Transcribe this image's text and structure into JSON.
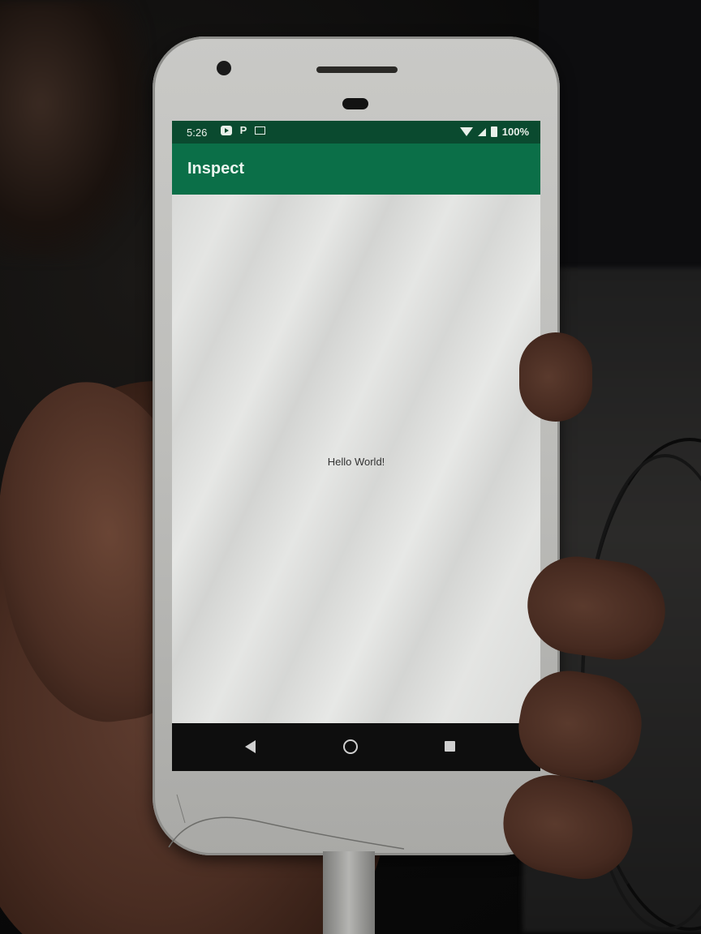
{
  "status_bar": {
    "time": "5:26",
    "battery": "100%",
    "icons_left": [
      "youtube-icon",
      "p-icon",
      "mail-icon"
    ],
    "icons_right": [
      "wifi-icon",
      "signal-icon",
      "battery-icon"
    ],
    "p_glyph": "P"
  },
  "app_bar": {
    "title": "Inspect",
    "color": "#0b6f48"
  },
  "content": {
    "text": "Hello World!",
    "background": "#e0e1df"
  },
  "nav_bar": {
    "buttons": [
      "back-icon",
      "home-icon",
      "recents-icon"
    ]
  },
  "colors": {
    "status_bar": "#0a4a2f",
    "app_bar": "#0b6f48",
    "nav_bar": "#0e0e0e"
  }
}
